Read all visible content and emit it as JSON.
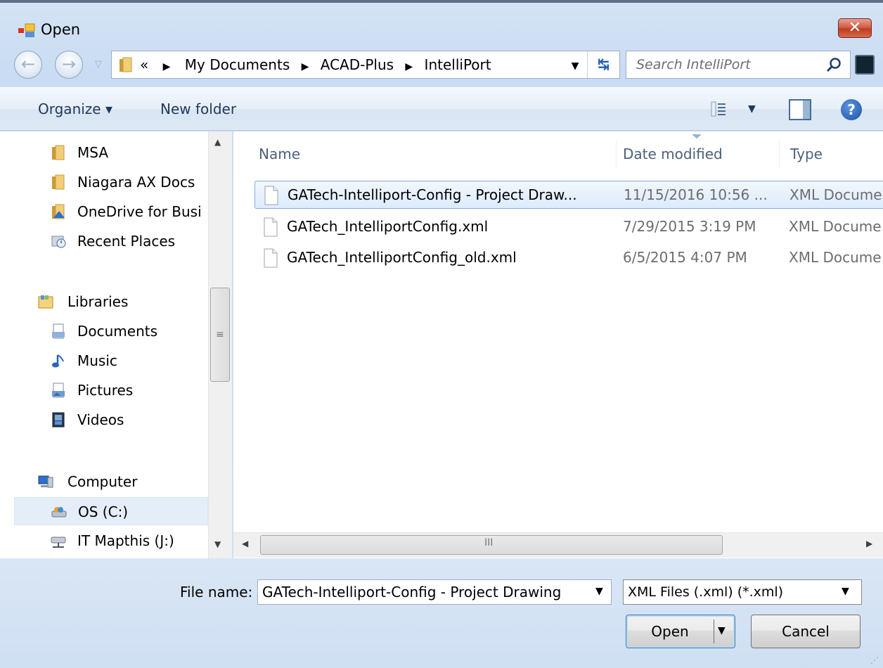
{
  "window": {
    "title": "Open",
    "close_label": "✕"
  },
  "address": {
    "overflow": "«",
    "crumbs": [
      "My Documents",
      "ACAD-Plus",
      "IntelliPort"
    ],
    "search_placeholder": "Search IntelliPort"
  },
  "commandbar": {
    "organize": "Organize ▾",
    "new_folder": "New folder"
  },
  "nav": {
    "items": [
      {
        "label": "MSA",
        "icon": "folder-icon",
        "kind": "child"
      },
      {
        "label": "Niagara AX Docs",
        "icon": "folder-icon",
        "kind": "child"
      },
      {
        "label": "OneDrive for Busi",
        "icon": "onedrive-icon",
        "kind": "child"
      },
      {
        "label": "Recent Places",
        "icon": "recent-places-icon",
        "kind": "child"
      },
      {
        "label": "Libraries",
        "icon": "libraries-icon",
        "kind": "root"
      },
      {
        "label": "Documents",
        "icon": "documents-icon",
        "kind": "child"
      },
      {
        "label": "Music",
        "icon": "music-icon",
        "kind": "child"
      },
      {
        "label": "Pictures",
        "icon": "pictures-icon",
        "kind": "child"
      },
      {
        "label": "Videos",
        "icon": "videos-icon",
        "kind": "child"
      },
      {
        "label": "Computer",
        "icon": "computer-icon",
        "kind": "root"
      },
      {
        "label": "OS (C:)",
        "icon": "drive-icon",
        "kind": "child",
        "selected": true
      },
      {
        "label": "IT Mapthis (J:)",
        "icon": "network-drive-icon",
        "kind": "child"
      }
    ]
  },
  "filelist": {
    "columns": [
      "Name",
      "Date modified",
      "Type"
    ],
    "rows": [
      {
        "name": "GATech-Intelliport-Config - Project Draw...",
        "date": "11/15/2016 10:56 ...",
        "type": "XML Docume",
        "selected": true
      },
      {
        "name": "GATech_IntelliportConfig.xml",
        "date": "7/29/2015 3:19 PM",
        "type": "XML Docume"
      },
      {
        "name": "GATech_IntelliportConfig_old.xml",
        "date": "6/5/2015 4:07 PM",
        "type": "XML Docume"
      }
    ],
    "hscroll_grip": "III"
  },
  "footer": {
    "file_name_label": "File name:",
    "file_name_value": "GATech-Intelliport-Config - Project Drawing",
    "file_type_value": "XML Files (.xml) (*.xml)",
    "open_label": "Open",
    "cancel_label": "Cancel"
  },
  "colors": {
    "accent": "#84acdd",
    "chrome": "#d4e3f5",
    "close": "#c13b22"
  }
}
